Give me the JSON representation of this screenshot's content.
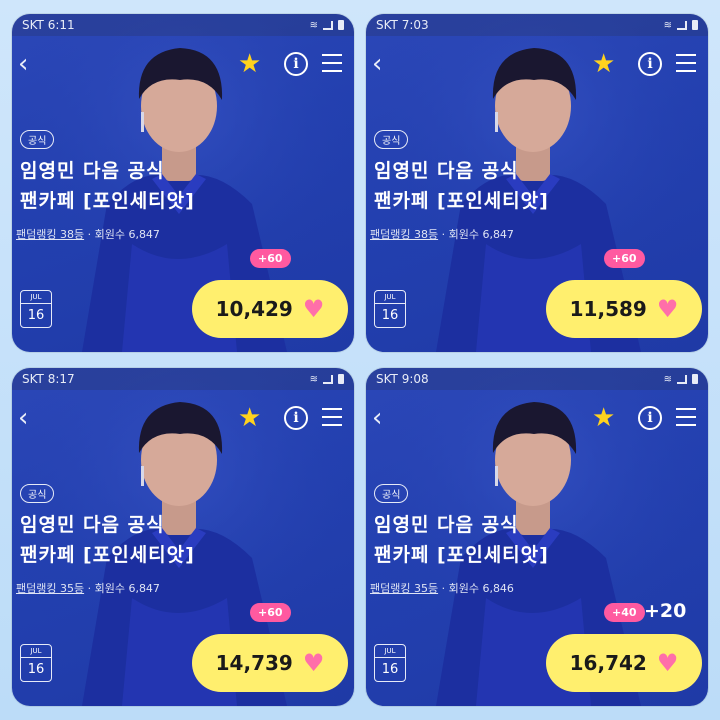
{
  "panels": [
    {
      "status": {
        "carrier_time": "SKT 6:11",
        "sys_icons": ""
      },
      "nav": {
        "back_icon": "‹",
        "star_icon": "★",
        "info_icon": "i"
      },
      "badge": "공식",
      "title_line1": "임영민 다음 공식",
      "title_line2": "팬카페 [포인세티앗]",
      "meta_rank": "팬덤랭킹 38등",
      "meta_members": "· 회원수 6,847",
      "plus": "+60",
      "plus_extra": "",
      "date": {
        "month": "JUL",
        "day": "16"
      },
      "hearts": "10,429",
      "heart_icon": "♥"
    },
    {
      "status": {
        "carrier_time": "SKT 7:03",
        "sys_icons": ""
      },
      "nav": {
        "back_icon": "‹",
        "star_icon": "★",
        "info_icon": "i"
      },
      "badge": "공식",
      "title_line1": "임영민 다음 공식",
      "title_line2": "팬카페 [포인세티앗]",
      "meta_rank": "팬덤랭킹 38등",
      "meta_members": "· 회원수 6,847",
      "plus": "+60",
      "plus_extra": "",
      "date": {
        "month": "JUL",
        "day": "16"
      },
      "hearts": "11,589",
      "heart_icon": "♥"
    },
    {
      "status": {
        "carrier_time": "SKT 8:17",
        "sys_icons": ""
      },
      "nav": {
        "back_icon": "‹",
        "star_icon": "★",
        "info_icon": "i"
      },
      "badge": "공식",
      "title_line1": "임영민 다음 공식",
      "title_line2": "팬카페 [포인세티앗]",
      "meta_rank": "팬덤랭킹 35등",
      "meta_members": "· 회원수 6,847",
      "plus": "+60",
      "plus_extra": "",
      "date": {
        "month": "JUL",
        "day": "16"
      },
      "hearts": "14,739",
      "heart_icon": "♥"
    },
    {
      "status": {
        "carrier_time": "SKT 9:08",
        "sys_icons": ""
      },
      "nav": {
        "back_icon": "‹",
        "star_icon": "★",
        "info_icon": "i"
      },
      "badge": "공식",
      "title_line1": "임영민 다음 공식",
      "title_line2": "팬카페 [포인세티앗]",
      "meta_rank": "팬덤랭킹 35등",
      "meta_members": "· 회원수 6,846",
      "plus": "+40",
      "plus_extra": "+20",
      "date": {
        "month": "JUL",
        "day": "16"
      },
      "hearts": "16,742",
      "heart_icon": "♥"
    }
  ],
  "colors": {
    "star": "#ffd21e",
    "heart": "#ff6fa9",
    "pill": "#ffef6e",
    "plus_badge": "#ff5aa0",
    "panel_blue": "#2340b0"
  }
}
